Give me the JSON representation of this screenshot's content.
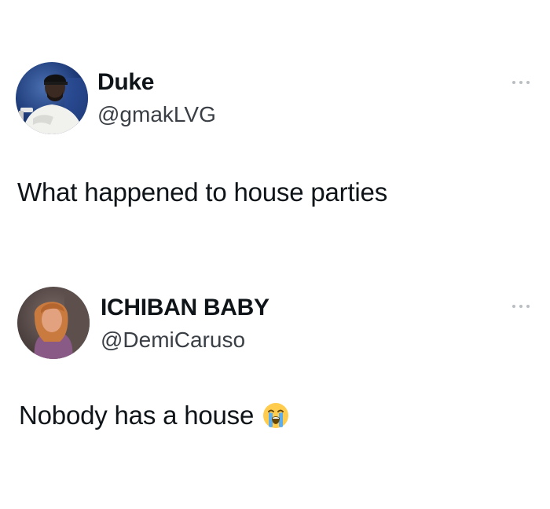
{
  "tweets": [
    {
      "display_name": "Duke",
      "handle": "@gmakLVG",
      "text": "What happened to house parties",
      "avatar_icon": "user-avatar-photo",
      "more_icon": "more-options-icon"
    },
    {
      "display_name": "ICHIBAN BABY",
      "handle": "@DemiCaruso",
      "text": "Nobody has a house",
      "emoji": "loudly-crying-face-icon",
      "avatar_icon": "user-avatar-photo",
      "more_icon": "more-options-icon"
    }
  ],
  "colors": {
    "text": "#0f1419",
    "handle": "#3a3f45",
    "more_dots": "#b9bec3",
    "background": "#ffffff"
  }
}
